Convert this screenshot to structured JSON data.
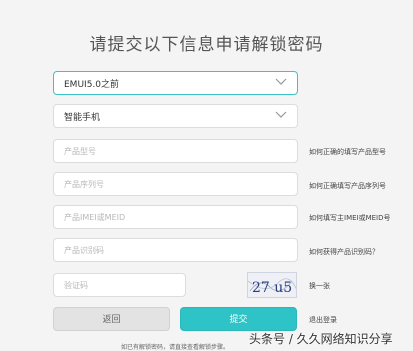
{
  "page": {
    "title": "请提交以下信息申请解锁密码"
  },
  "form": {
    "system_version": "EMUI5.0之前",
    "device_type": "智能手机",
    "model_placeholder": "产品型号",
    "serial_placeholder": "产品序列号",
    "imei_placeholder": "产品IMEI或MEID",
    "id_code_placeholder": "产品识别码",
    "captcha_placeholder": "验证码",
    "captcha_image_text": "27 u5"
  },
  "help_links": {
    "model": "如何正确的填写产品型号",
    "serial": "如何正确填写产品序列号",
    "imei": "如何填写主IMEI或MEID号",
    "id_code": "如何获得产品识别码？",
    "refresh_captcha": "换一张",
    "logout": "退出登录"
  },
  "buttons": {
    "back": "返回",
    "submit": "提交"
  },
  "footnote": "如已有解锁密码，请直接查看解锁步骤。",
  "watermark": "头条号 / 久久网络知识分享",
  "colors": {
    "accent": "#2ec3c6",
    "border_active": "#3fc1c9",
    "background": "#f4f4f4"
  },
  "icons": {
    "dropdown": "chevron-down-icon"
  }
}
